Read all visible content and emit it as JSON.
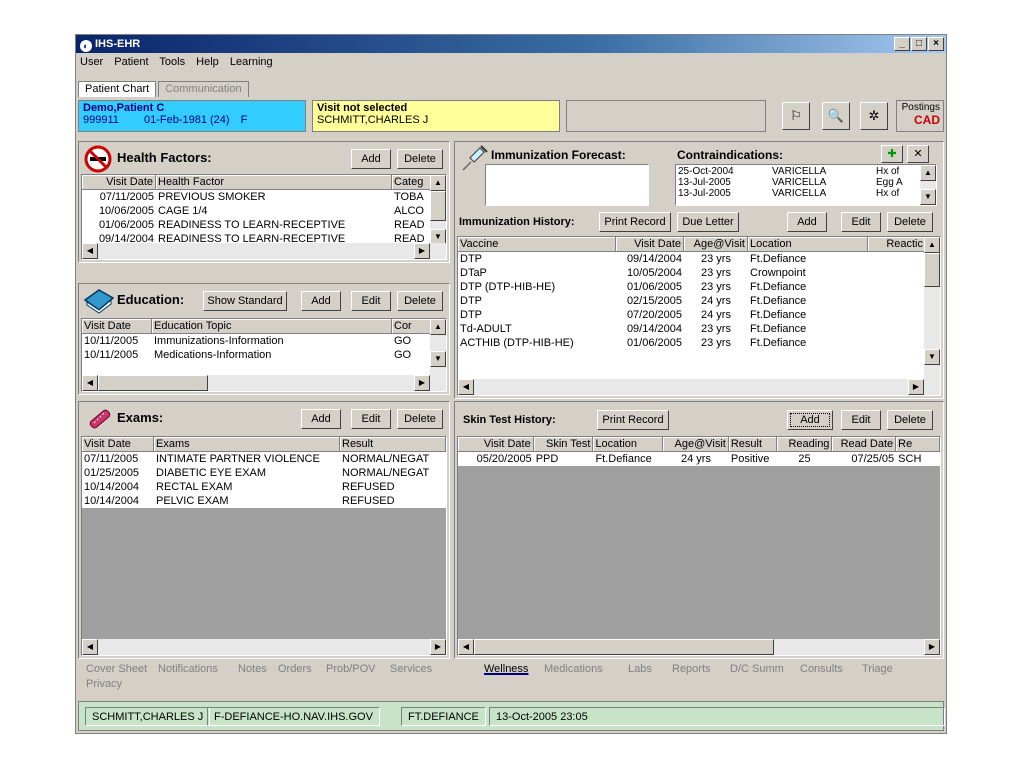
{
  "window": {
    "title": "IHS-EHR",
    "min": "_",
    "max": "□",
    "close": "×"
  },
  "menu": [
    "User",
    "Patient",
    "Tools",
    "Help",
    "Learning"
  ],
  "top_tabs": [
    {
      "label": "Patient Chart"
    },
    {
      "label": "Communication"
    }
  ],
  "patient": {
    "name": "Demo,Patient C",
    "id": "999911",
    "dob": "01-Feb-1981",
    "age": "(24)",
    "sex": "F"
  },
  "visit": {
    "status": "Visit not selected",
    "provider": "SCHMITT,CHARLES J"
  },
  "posting": {
    "label": "Postings",
    "value": "CAD"
  },
  "health_factors": {
    "title": "Health Factors:",
    "add": "Add",
    "delete": "Delete",
    "columns": [
      "Visit Date",
      "Health Factor",
      "Categ"
    ],
    "rows": [
      [
        "07/11/2005",
        "PREVIOUS SMOKER",
        "TOBA"
      ],
      [
        "10/06/2005",
        "CAGE 1/4",
        "ALCO"
      ],
      [
        "01/06/2005",
        "READINESS TO LEARN-RECEPTIVE",
        "READ"
      ],
      [
        "09/14/2004",
        "READINESS TO LEARN-RECEPTIVE",
        "READ"
      ]
    ]
  },
  "education": {
    "title": "Education:",
    "show_standard": "Show Standard",
    "add": "Add",
    "edit": "Edit",
    "delete": "Delete",
    "columns": [
      "Visit Date",
      "Education Topic",
      "Cor"
    ],
    "rows": [
      [
        "10/11/2005",
        "Immunizations-Information",
        "GO"
      ],
      [
        "10/11/2005",
        "Medications-Information",
        "GO"
      ]
    ]
  },
  "exams": {
    "title": "Exams:",
    "add": "Add",
    "edit": "Edit",
    "delete": "Delete",
    "columns": [
      "Visit Date",
      "Exams",
      "Result"
    ],
    "rows": [
      [
        "07/11/2005",
        "INTIMATE PARTNER VIOLENCE",
        "NORMAL/NEGAT"
      ],
      [
        "01/25/2005",
        "DIABETIC EYE EXAM",
        "NORMAL/NEGAT"
      ],
      [
        "10/14/2004",
        "RECTAL EXAM",
        "REFUSED"
      ],
      [
        "10/14/2004",
        "PELVIC EXAM",
        "REFUSED"
      ]
    ]
  },
  "immunization_forecast": {
    "title": "Immunization Forecast:"
  },
  "contraindications": {
    "title": "Contraindications:",
    "rows": [
      [
        "25-Oct-2004",
        "VARICELLA",
        "Hx of"
      ],
      [
        "13-Jul-2005",
        "VARICELLA",
        "Egg A"
      ],
      [
        "13-Jul-2005",
        "VARICELLA",
        "Hx of"
      ]
    ]
  },
  "immunization_history": {
    "title": "Immunization History:",
    "print_record": "Print Record",
    "due_letter": "Due Letter",
    "add": "Add",
    "edit": "Edit",
    "delete": "Delete",
    "columns": [
      "Vaccine",
      "Visit Date",
      "Age@Visit",
      "Location",
      "Reactic"
    ],
    "rows": [
      [
        "DTP",
        "09/14/2004",
        "23 yrs",
        "Ft.Defiance",
        ""
      ],
      [
        "DTaP",
        "10/05/2004",
        "23 yrs",
        "Crownpoint",
        ""
      ],
      [
        "DTP (DTP-HIB-HE)",
        "01/06/2005",
        "23 yrs",
        "Ft.Defiance",
        ""
      ],
      [
        "DTP",
        "02/15/2005",
        "24 yrs",
        "Ft.Defiance",
        ""
      ],
      [
        "DTP",
        "07/20/2005",
        "24 yrs",
        "Ft.Defiance",
        ""
      ],
      [
        "Td-ADULT",
        "09/14/2004",
        "23 yrs",
        "Ft.Defiance",
        ""
      ],
      [
        "ACTHIB (DTP-HIB-HE)",
        "01/06/2005",
        "23 yrs",
        "Ft.Defiance",
        ""
      ]
    ]
  },
  "skin_test": {
    "title": "Skin Test History:",
    "print_record": "Print Record",
    "add": "Add",
    "edit": "Edit",
    "delete": "Delete",
    "columns": [
      "Visit Date",
      "Skin Test",
      "Location",
      "Age@Visit",
      "Result",
      "Reading",
      "Read Date",
      "Re"
    ],
    "rows": [
      [
        "05/20/2005",
        "PPD",
        "Ft.Defiance",
        "24 yrs",
        "Positive",
        "25",
        "07/25/05",
        "SCH"
      ]
    ]
  },
  "bottom_tabs": [
    "Cover Sheet",
    "Notifications",
    "Notes",
    "Orders",
    "Prob/POV",
    "Services",
    "Wellness",
    "Medications",
    "Labs",
    "Reports",
    "D/C Summ",
    "Consults",
    "Triage",
    "Privacy"
  ],
  "status": {
    "user": "SCHMITT,CHARLES J",
    "server": "F-DEFIANCE-HO.NAV.IHS.GOV",
    "facility": "FT.DEFIANCE",
    "datetime": "13-Oct-2005 23:05"
  },
  "icons": {
    "health_factors": "no-smoking-icon",
    "education": "book-icon",
    "exams": "bandage-icon",
    "immunization": "syringe-icon"
  }
}
